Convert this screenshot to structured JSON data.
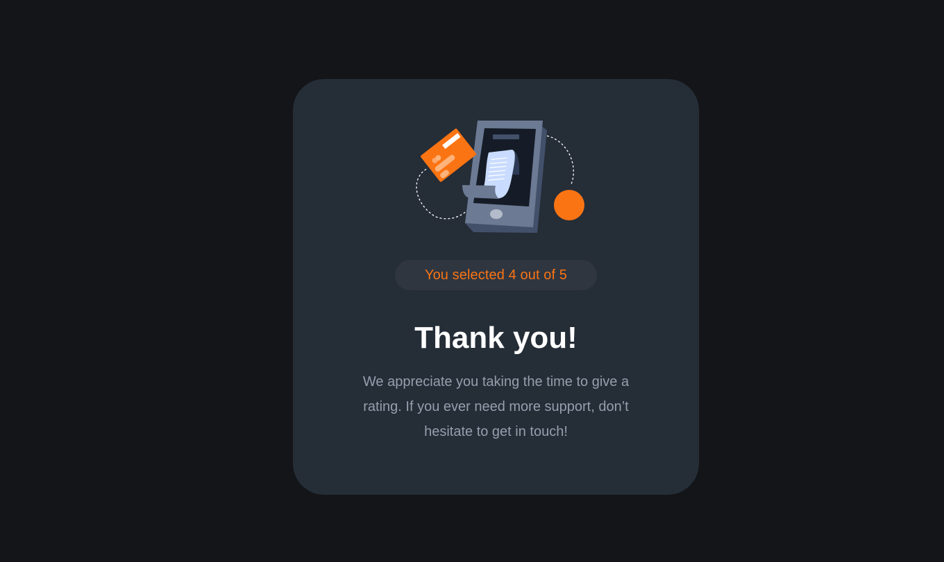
{
  "illustration": {
    "name": "card-payment-illustration",
    "accent_color": "#fb7413",
    "phone_color": "#6c7a94",
    "receipt_color": "#c9dcff"
  },
  "rating": {
    "selected_text": "You selected 4 out of 5",
    "selected_value": 4,
    "max_value": 5
  },
  "thank_you": {
    "title": "Thank you!",
    "message": "We appreciate you taking the time to give a rating. If you ever need more support, don’t hesitate to get in touch!"
  },
  "colors": {
    "background": "#131518",
    "card": "#252d37",
    "accent": "#fb7413",
    "title": "#ffffff",
    "body_text": "#969fad"
  }
}
